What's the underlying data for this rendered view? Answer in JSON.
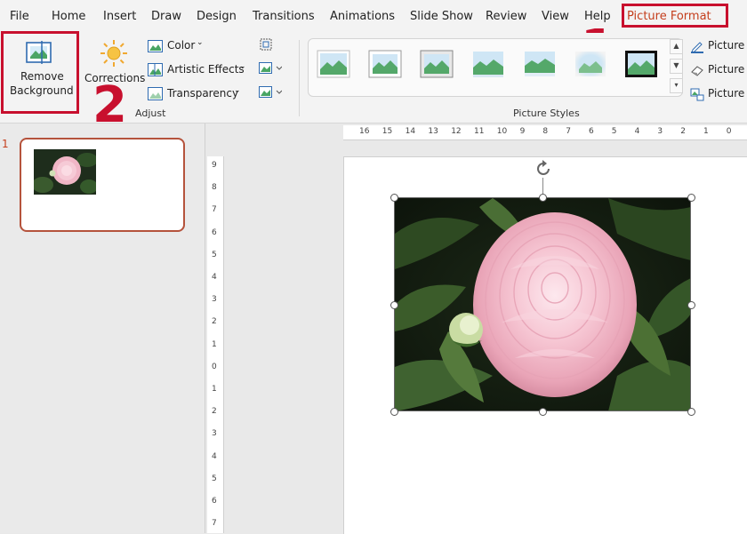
{
  "menu": {
    "tabs": [
      "File",
      "Home",
      "Insert",
      "Draw",
      "Design",
      "Transitions",
      "Animations",
      "Slide Show",
      "Review",
      "View",
      "Help",
      "Picture Format"
    ],
    "active_tab": "Picture Format"
  },
  "ribbon": {
    "remove_background": {
      "line1": "Remove",
      "line2": "Background"
    },
    "corrections": "Corrections",
    "color": "Color",
    "artistic_effects": "Artistic Effects",
    "transparency": "Transparency",
    "adjust_group": "Adjust",
    "picture_styles_group": "Picture Styles",
    "picture_border": "Picture",
    "picture_effects": "Picture",
    "picture_layout": "Picture"
  },
  "annotations": {
    "step1": "1",
    "step2": "2"
  },
  "slides": [
    {
      "number": "1"
    }
  ],
  "ruler": {
    "horizontal": [
      "16",
      "15",
      "14",
      "13",
      "12",
      "11",
      "10",
      "9",
      "8",
      "7",
      "6",
      "5",
      "4",
      "3",
      "2",
      "1",
      "0"
    ],
    "vertical": [
      "9",
      "8",
      "7",
      "6",
      "5",
      "4",
      "3",
      "2",
      "1",
      "0",
      "1",
      "2",
      "3",
      "4",
      "5",
      "6",
      "7"
    ]
  },
  "colors": {
    "accent": "#c43e1c",
    "annotation": "#c8102e",
    "thumb_border": "#b5533c"
  }
}
